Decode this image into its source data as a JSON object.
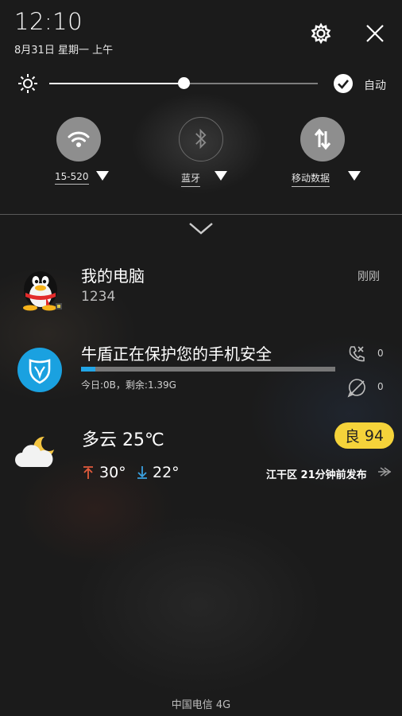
{
  "status": {
    "time": "12:10",
    "date": "8月31日 星期一 上午"
  },
  "brightness": {
    "level_percent": 50,
    "auto_label": "自动",
    "auto_checked": true
  },
  "toggles": [
    {
      "label": "15-520",
      "icon": "wifi-icon",
      "on": true
    },
    {
      "label": "蓝牙",
      "icon": "bluetooth-icon",
      "on": false
    },
    {
      "label": "移动数据",
      "icon": "mobile-data-icon",
      "on": true
    }
  ],
  "notifications": {
    "qq": {
      "title": "我的电脑",
      "subtitle": "1234",
      "time": "刚刚",
      "icon": "qq-penguin-icon"
    },
    "security": {
      "title": "牛盾正在保护您的手机安全",
      "usage_text": "今日:0B，剩余:1.39G",
      "progress_fraction": 0.055,
      "calls_blocked": "0",
      "messages_blocked": "0",
      "icon": "shield-bull-icon",
      "accent": "#1aa1e0"
    },
    "weather": {
      "condition_temp": "多云 25℃",
      "aqi_label": "良",
      "aqi_value": "94",
      "high": "30°",
      "low": "22°",
      "published": "江干区 21分钟前发布",
      "icon": "cloudy-moon-icon",
      "aqi_color": "#f5d33a",
      "high_arrow_color": "#e35a3c",
      "low_arrow_color": "#3aa0e0"
    }
  },
  "carrier": "中国电信 4G"
}
